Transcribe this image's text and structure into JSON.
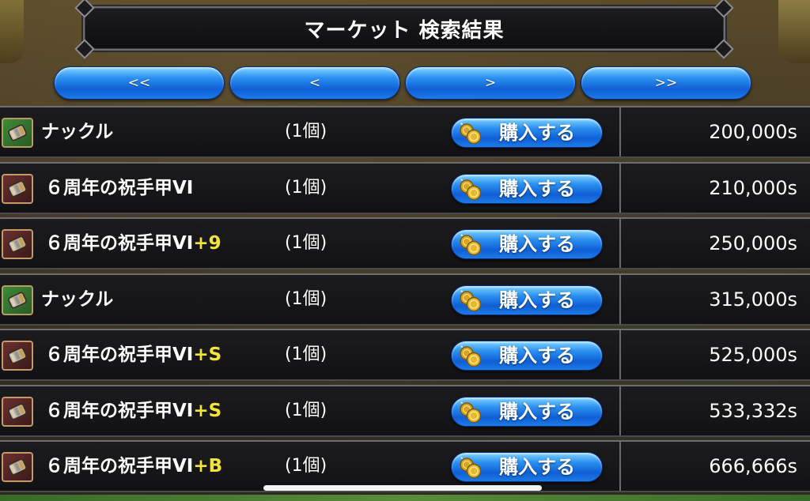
{
  "title": "マーケット 検索結果",
  "pager": {
    "first": "<<",
    "prev": "<",
    "next": ">",
    "last": ">>"
  },
  "colors": {
    "button_blue": "#1c7be8",
    "suffix_yellow": "#f2e43a",
    "row_bg": "#161618"
  },
  "listings": [
    {
      "icon": "knuckle-icon",
      "icon_bg": "green",
      "name": "ナックル",
      "suffix": "",
      "qty": "(1個)",
      "buy_label": "購入する",
      "price": "200,000s"
    },
    {
      "icon": "gauntlet-icon",
      "icon_bg": "red",
      "name": "６周年の祝手甲VI",
      "suffix": "",
      "qty": "(1個)",
      "buy_label": "購入する",
      "price": "210,000s"
    },
    {
      "icon": "gauntlet-icon",
      "icon_bg": "red",
      "name": "６周年の祝手甲VI",
      "suffix": "+9",
      "qty": "(1個)",
      "buy_label": "購入する",
      "price": "250,000s"
    },
    {
      "icon": "knuckle-icon",
      "icon_bg": "green",
      "name": "ナックル",
      "suffix": "",
      "qty": "(1個)",
      "buy_label": "購入する",
      "price": "315,000s"
    },
    {
      "icon": "gauntlet-icon",
      "icon_bg": "red",
      "name": "６周年の祝手甲VI",
      "suffix": "+S",
      "qty": "(1個)",
      "buy_label": "購入する",
      "price": "525,000s"
    },
    {
      "icon": "gauntlet-icon",
      "icon_bg": "red",
      "name": "６周年の祝手甲VI",
      "suffix": "+S",
      "qty": "(1個)",
      "buy_label": "購入する",
      "price": "533,332s"
    },
    {
      "icon": "gauntlet-icon",
      "icon_bg": "red",
      "name": "６周年の祝手甲VI",
      "suffix": "+B",
      "qty": "(1個)",
      "buy_label": "購入する",
      "price": "666,666s"
    }
  ]
}
